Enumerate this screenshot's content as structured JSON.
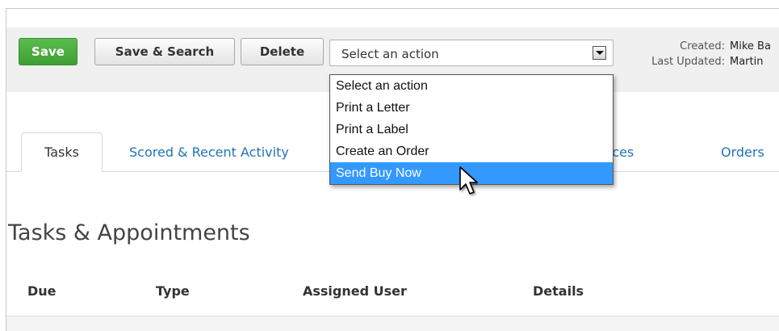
{
  "toolbar": {
    "save_label": "Save",
    "save_search_label": "Save & Search",
    "delete_label": "Delete",
    "action_select": {
      "value": "Select an action",
      "options": [
        "Select an action",
        "Print a Letter",
        "Print a Label",
        "Create an Order",
        "Send Buy Now"
      ],
      "highlighted": "Send Buy Now"
    }
  },
  "meta": {
    "created_label": "Created:",
    "created_value": "Mike Ba",
    "updated_label": "Last Updated:",
    "updated_value": "Martin"
  },
  "tabs": [
    {
      "label": "Tasks",
      "active": true
    },
    {
      "label": "Scored & Recent Activity",
      "active": false
    },
    {
      "label": "quences",
      "active": false
    },
    {
      "label": "Orders",
      "active": false
    }
  ],
  "section": {
    "title": "Tasks & Appointments"
  },
  "table": {
    "columns": [
      "Due",
      "Type",
      "Assigned User",
      "Details"
    ]
  },
  "colors": {
    "save_green": "#4cae40",
    "link_blue": "#2173b8",
    "highlight_blue": "#3399ff"
  }
}
